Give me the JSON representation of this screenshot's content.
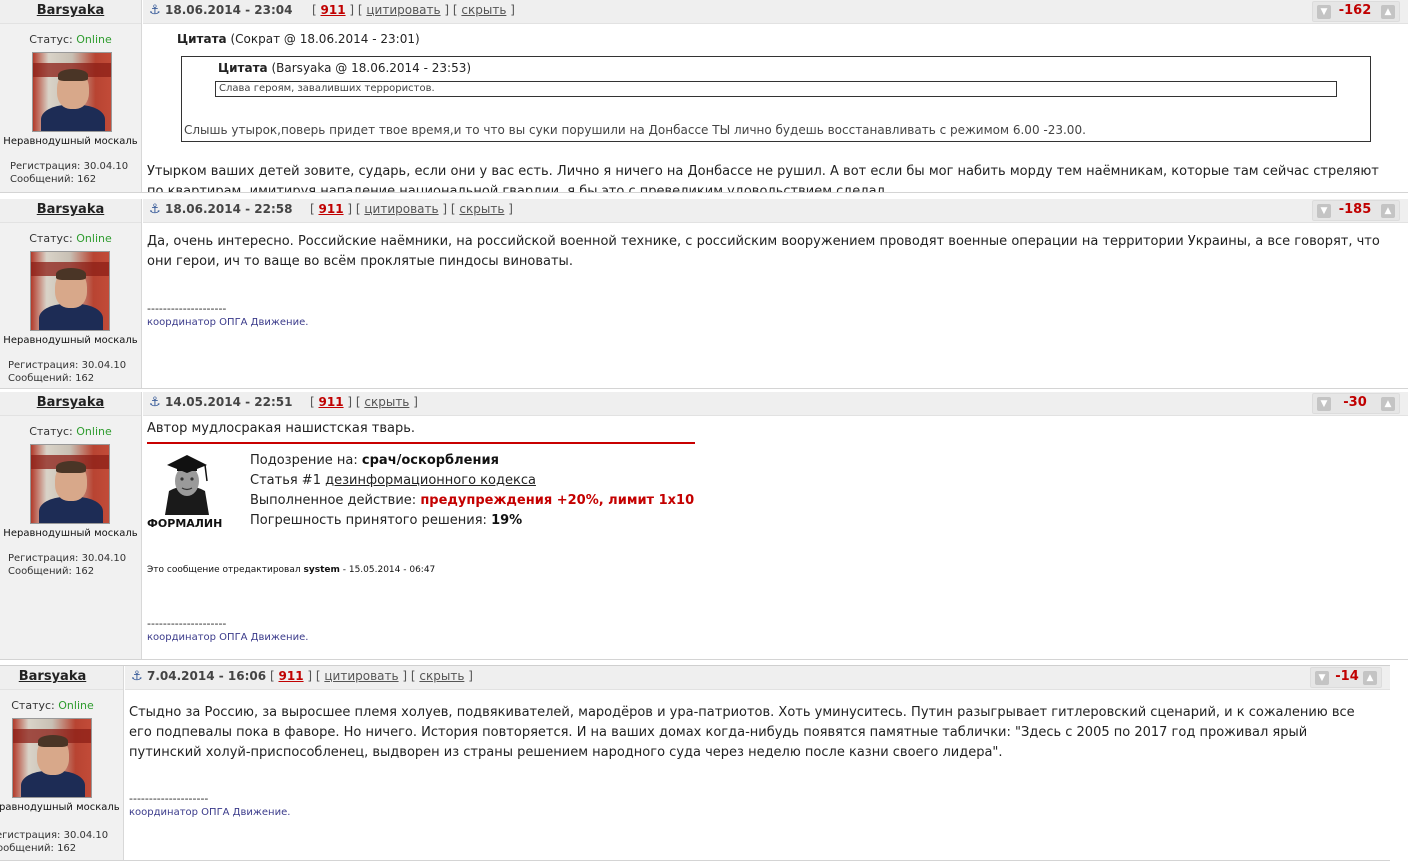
{
  "posts": [
    {
      "user": "Barsyaka",
      "status_label": "Статус:",
      "status_value": "Online",
      "rank": "Неравнодушный москаль",
      "reg_label": "Регистрация:",
      "reg_date": "30.04.10",
      "msg_label": "Сообщений:",
      "msg_count": "162",
      "date": "18.06.2014 - 23:04",
      "post_num": "911",
      "quote_link": "цитировать",
      "hide_link": "скрыть",
      "rating": "-162",
      "quote": {
        "title": "Цитата",
        "meta": "(Сократ @ 18.06.2014 - 23:01)",
        "inner_title": "Цитата",
        "inner_meta": "(Barsyaka @ 18.06.2014 - 23:53)",
        "inner_text": "Слава героям, заваливших террористов.",
        "reply": "Слышь утырок,поверь придет твое время,и то что вы суки порушили на Донбассе ТЫ лично будешь восстанавливать с режимом 6.00 -23.00."
      },
      "text": "Утырком ваших детей зовите, сударь, если они у вас есть. Лично я ничего на Донбассе не рушил. А вот если бы мог набить морду тем наёмникам, которые там сейчас стреляют по квартирам, имитируя нападение национальной гвардии, я бы это с превеликим удовольствием сделал."
    },
    {
      "user": "Barsyaka",
      "status_label": "Статус:",
      "status_value": "Online",
      "rank": "Неравнодушный москаль",
      "reg_label": "Регистрация:",
      "reg_date": "30.04.10",
      "msg_label": "Сообщений:",
      "msg_count": "162",
      "date": "18.06.2014 - 22:58",
      "post_num": "911",
      "quote_link": "цитировать",
      "hide_link": "скрыть",
      "rating": "-185",
      "text": "Да, очень интересно. Российские наёмники, на российской военной технике, с российским вооружением проводят военные операции на территории Украины, а все говорят, что они герои, ич то ваще во всём проклятые пиндосы виноваты.",
      "sig_line": "--------------------",
      "signature": "координатор ОПГА Движение."
    },
    {
      "user": "Barsyaka",
      "status_label": "Статус:",
      "status_value": "Online",
      "rank": "Неравнодушный москаль",
      "reg_label": "Регистрация:",
      "reg_date": "30.04.10",
      "msg_label": "Сообщений:",
      "msg_count": "162",
      "date": "14.05.2014 - 22:51",
      "post_num": "911",
      "hide_link": "скрыть",
      "rating": "-30",
      "text": "Автор мудлосракая нашистская тварь.",
      "moderation": {
        "judge": "ФОРМАЛИН",
        "suspicion_label": "Подозрение на:",
        "suspicion": "срач/оскорбления",
        "article_label": "Статья #1",
        "article": "дезинформационного кодекса",
        "action_label": "Выполненное действие:",
        "action": "предупреждения +20%, лимит 1х10",
        "error_label": "Погрешность принятого решения:",
        "error": "19%"
      },
      "edited_prefix": "Это сообщение отредактировал",
      "edited_by": "system",
      "edited_date": "- 15.05.2014 - 06:47",
      "sig_line": "--------------------",
      "signature": "координатор ОПГА Движение."
    },
    {
      "user": "Barsyaka",
      "status_label": "Статус:",
      "status_value": "Online",
      "rank": "Неравнодушный москаль",
      "reg_label": "Регистрация:",
      "reg_date": "30.04.10",
      "msg_label": "Сообщений:",
      "msg_count": "162",
      "date": "7.04.2014 - 16:06",
      "post_num": "911",
      "quote_link": "цитировать",
      "hide_link": "скрыть",
      "rating": "-14",
      "text": "Стыдно за Россию, за выросшее племя холуев, подвякивателей, мародёров и ура-патриотов. Хоть уминуситесь. Путин разыгрывает гитлеровский сценарий, и к сожалению все его подпевалы пока в фаворе. Но ничего. История повторяется. И на ваших домах когда-нибудь появятся памятные таблички: \"Здесь с 2005 по 2017 год проживал ярый путинский холуй-приспособленец, выдворен из страны решением народного суда через неделю после казни своего лидера\".",
      "sig_line": "--------------------",
      "signature": "координатор ОПГА Движение."
    }
  ]
}
